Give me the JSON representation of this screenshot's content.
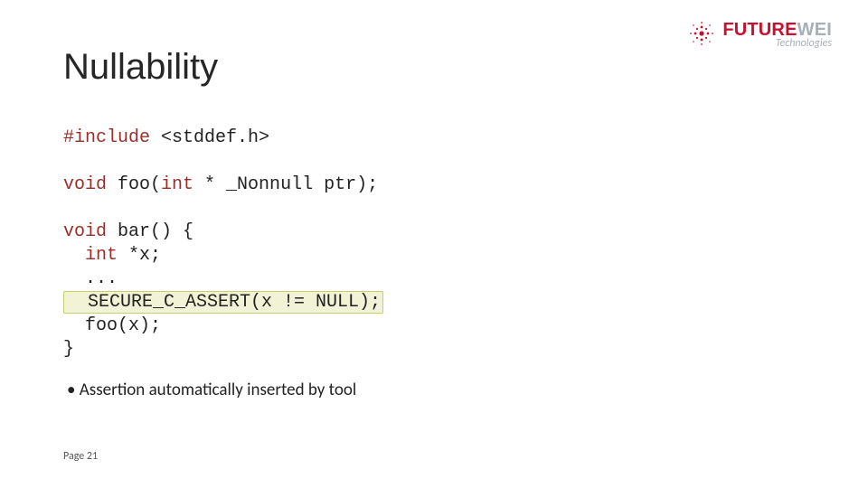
{
  "logo": {
    "main_a": "FUTURE",
    "main_b": "WEI",
    "sub": "Technologies"
  },
  "title": "Nullability",
  "code": {
    "l1_a": "#include",
    "l1_b": " <stddef.h>",
    "l2_a": "void",
    "l2_b": " foo(",
    "l2_c": "int",
    "l2_d": " * _Nonnull ptr);",
    "l3_a": "void",
    "l3_b": " bar() {",
    "l4_a": "  ",
    "l4_b": "int",
    "l4_c": " *x;",
    "l5": "  ...",
    "l6": "  SECURE_C_ASSERT(x != NULL);",
    "l7": "  foo(x);",
    "l8": "}"
  },
  "bullet": "Assertion automatically inserted by tool",
  "page": "Page 21"
}
